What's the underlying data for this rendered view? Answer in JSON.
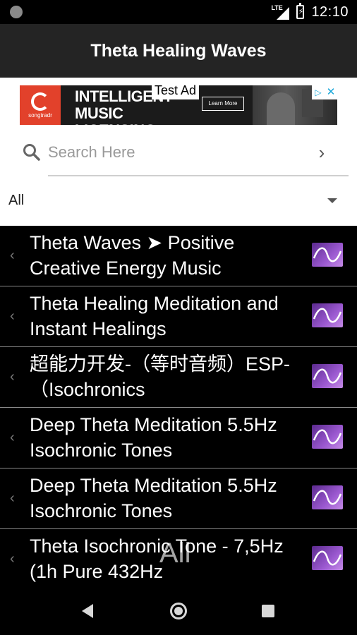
{
  "status_bar": {
    "network_label": "LTE",
    "time": "12:10",
    "icons": [
      "notification-dot-icon",
      "lte-signal-icon",
      "battery-charging-icon"
    ]
  },
  "app_bar": {
    "title": "Theta Healing Waves"
  },
  "ad": {
    "brand": "songtradr",
    "headline": "INTELLIGENT MUSIC LICENSING",
    "cta": "Learn More",
    "test_label": "Test Ad",
    "icons": [
      "ad-choices-icon",
      "close-icon"
    ]
  },
  "search": {
    "placeholder": "Search Here",
    "value": "",
    "icons": [
      "search-icon",
      "chevron-right-icon"
    ]
  },
  "filter": {
    "selected": "All",
    "icon": "dropdown-arrow-icon"
  },
  "list": {
    "items": [
      {
        "title": "Theta Waves ➤ Positive Creative Energy Music",
        "thumb_icon": "wave-thumbnail-icon"
      },
      {
        "title": "Theta Healing Meditation and Instant Healings",
        "thumb_icon": "wave-thumbnail-icon"
      },
      {
        "title": "超能力开发-（等时音频）ESP-（Isochronics",
        "thumb_icon": "wave-thumbnail-icon"
      },
      {
        "title": "Deep Theta Meditation 5.5Hz Isochronic Tones",
        "thumb_icon": "wave-thumbnail-icon"
      },
      {
        "title": "Deep Theta Meditation 5.5Hz Isochronic Tones",
        "thumb_icon": "wave-thumbnail-icon"
      },
      {
        "title": "Theta Isochronic Tone - 7,5Hz (1h Pure 432Hz",
        "thumb_icon": "wave-thumbnail-icon"
      }
    ]
  },
  "overlay": {
    "label": "All"
  },
  "nav_bar": {
    "icons": [
      "back-icon",
      "home-icon",
      "recents-icon"
    ]
  }
}
